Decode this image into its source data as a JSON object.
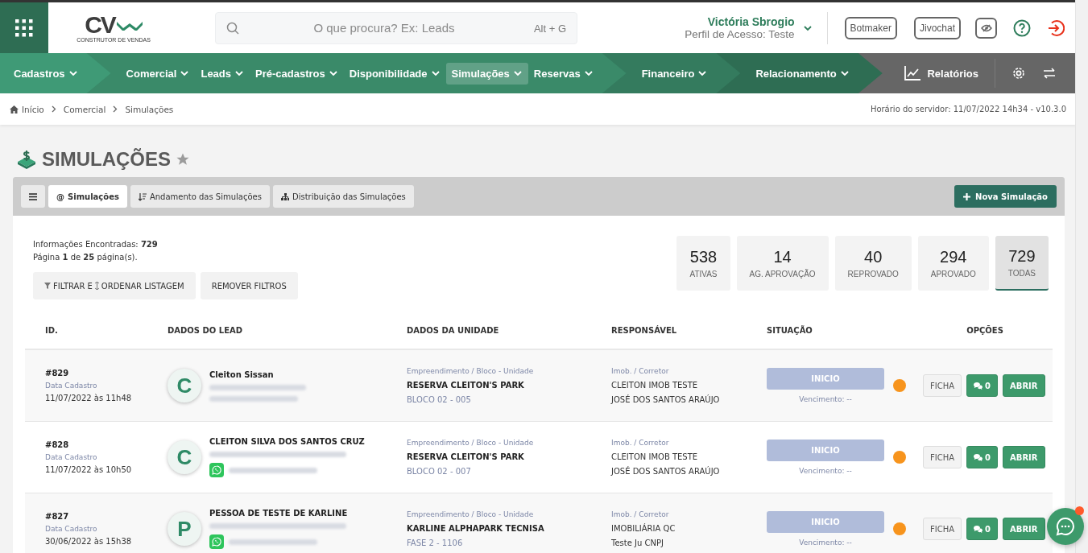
{
  "header": {
    "search": {
      "placeholder": "O que procura? Ex: Leads",
      "shortcut": "Alt + G"
    },
    "logo": {
      "mark": "CV",
      "tagline": "CONSTRUTOR DE VENDAS"
    },
    "user": {
      "name": "Victória Sbrogio",
      "profile": "Perfil de Acesso: Teste"
    },
    "buttons": [
      "Botmaker",
      "Jivochat"
    ]
  },
  "nav": {
    "groups": [
      {
        "color": "#3f9a76",
        "items": [
          {
            "label": "Cadastros",
            "selected": false
          }
        ]
      },
      {
        "color": "#3a8a69",
        "items": [
          {
            "label": "Comercial",
            "selected": false
          },
          {
            "label": "Leads",
            "selected": false
          },
          {
            "label": "Pré-cadastros",
            "selected": false
          },
          {
            "label": "Disponibilidade",
            "selected": false
          },
          {
            "label": "Simulações",
            "selected": true
          },
          {
            "label": "Reservas",
            "selected": false
          }
        ]
      },
      {
        "color": "#347b5e",
        "items": [
          {
            "label": "Financeiro",
            "selected": false
          }
        ]
      },
      {
        "color": "#2e6d53",
        "items": [
          {
            "label": "Relacionamento",
            "selected": false
          }
        ]
      }
    ],
    "reports": "Relatórios"
  },
  "breadcrumb": [
    "Início",
    "Comercial",
    "Simulações"
  ],
  "server_time": "Horário do servidor: 11/07/2022 14h34 - v10.3.0",
  "page_title": "SIMULAÇÕES",
  "tabs": [
    {
      "label": "Simulações",
      "kind": "at",
      "glyph": "@",
      "selected": true
    },
    {
      "label": "Andamento das Simulações",
      "kind": "sort",
      "selected": false
    },
    {
      "label": "Distribuição das Simulações",
      "kind": "sitemap",
      "selected": false
    }
  ],
  "new_button": "Nova Simulação",
  "summary": {
    "found": "Informações Encontradas: **729**",
    "page": "Página **1** de **25** página(s)."
  },
  "filter_buttons": [
    {
      "label_before": "FILTRAR E",
      "label_after": "ORDENAR LISTAGEM"
    },
    {
      "label": "REMOVER FILTROS"
    }
  ],
  "stats": [
    {
      "value": "538",
      "label": "ATIVAS",
      "selected": false
    },
    {
      "value": "14",
      "label": "AG. APROVAÇÃO",
      "selected": false
    },
    {
      "value": "40",
      "label": "REPROVADO",
      "selected": false
    },
    {
      "value": "294",
      "label": "APROVADO",
      "selected": false
    },
    {
      "value": "729",
      "label": "TODAS",
      "selected": true
    }
  ],
  "table": {
    "columns": [
      "ID.",
      "DADOS DO LEAD",
      "DADOS DA UNIDADE",
      "RESPONSÁVEL",
      "SITUAÇÃO",
      "OPÇÕES"
    ],
    "rows": [
      {
        "id": "#829",
        "date_label": "Data Cadastro",
        "date": "11/07/2022 às 11h48",
        "initial": "C",
        "lead": "Cleiton Sissan",
        "whatsapp": false,
        "unit_label": "Empreendimento / Bloco - Unidade",
        "project": "RESERVA CLEITON'S PARK",
        "unit": "BLOCO 02 - 005",
        "resp_label": "Imob. / Corretor",
        "agency": "CLEITON IMOB TESTE",
        "broker": "JOSÉ DOS SANTOS ARAÚJO",
        "status": "INICIO",
        "due": "Vencimento: --",
        "color": "#f7941d",
        "sheet": "FICHA",
        "comments": "0",
        "open": "ABRIR"
      },
      {
        "id": "#828",
        "date_label": "Data Cadastro",
        "date": "11/07/2022 às 10h50",
        "initial": "C",
        "lead": "CLEITON SILVA DOS SANTOS CRUZ",
        "whatsapp": true,
        "unit_label": "Empreendimento / Bloco - Unidade",
        "project": "RESERVA CLEITON'S PARK",
        "unit": "BLOCO 02 - 007",
        "resp_label": "Imob. / Corretor",
        "agency": "CLEITON IMOB TESTE",
        "broker": "JOSÉ DOS SANTOS ARAÚJO",
        "status": "INICIO",
        "due": "Vencimento: --",
        "color": "#f7941d",
        "sheet": "FICHA",
        "comments": "0",
        "open": "ABRIR"
      },
      {
        "id": "#827",
        "date_label": "Data Cadastro",
        "date": "30/06/2022 às 15h38",
        "initial": "P",
        "lead": "PESSOA DE TESTE DE KARLINE",
        "whatsapp": true,
        "unit_label": "Empreendimento / Bloco - Unidade",
        "project": "KARLINE ALPHAPARK TECNISA",
        "unit": "FASE 2 - 1106",
        "resp_label": "Imob. / Corretor",
        "agency": "IMOBILIÁRIA QC",
        "broker": "Teste Ju CNPJ",
        "status": "INICIO",
        "due": "Vencimento: --",
        "color": "#f7941d",
        "sheet": "FICHA",
        "comments": "0",
        "open": "ABRIR"
      }
    ]
  }
}
